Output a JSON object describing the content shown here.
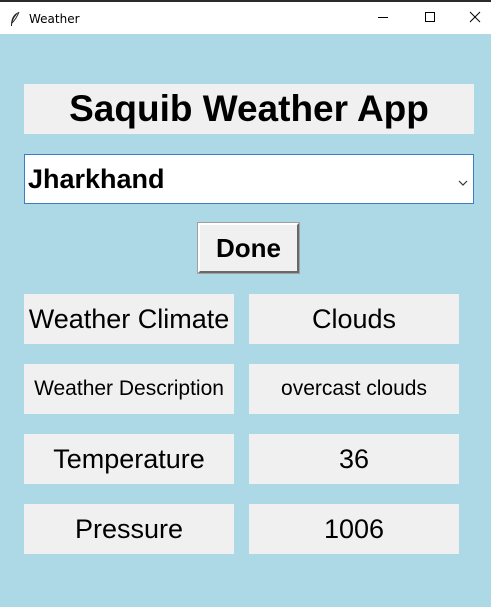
{
  "window": {
    "title": "Weather",
    "icon": "feather-icon",
    "controls": [
      "minimize-icon",
      "maximize-icon",
      "close-icon"
    ]
  },
  "app": {
    "heading": "Saquib Weather App",
    "state_select": {
      "value": "Jharkhand"
    },
    "done_label": "Done",
    "rows": [
      {
        "label": "Weather Climate",
        "value": "Clouds"
      },
      {
        "label": "Weather Description",
        "value": "overcast clouds"
      },
      {
        "label": "Temperature",
        "value": "36"
      },
      {
        "label": "Pressure",
        "value": "1006"
      }
    ]
  },
  "colors": {
    "background": "#add8e6",
    "label_bg": "#f0f0f0",
    "combo_border": "#3a7ec4"
  }
}
